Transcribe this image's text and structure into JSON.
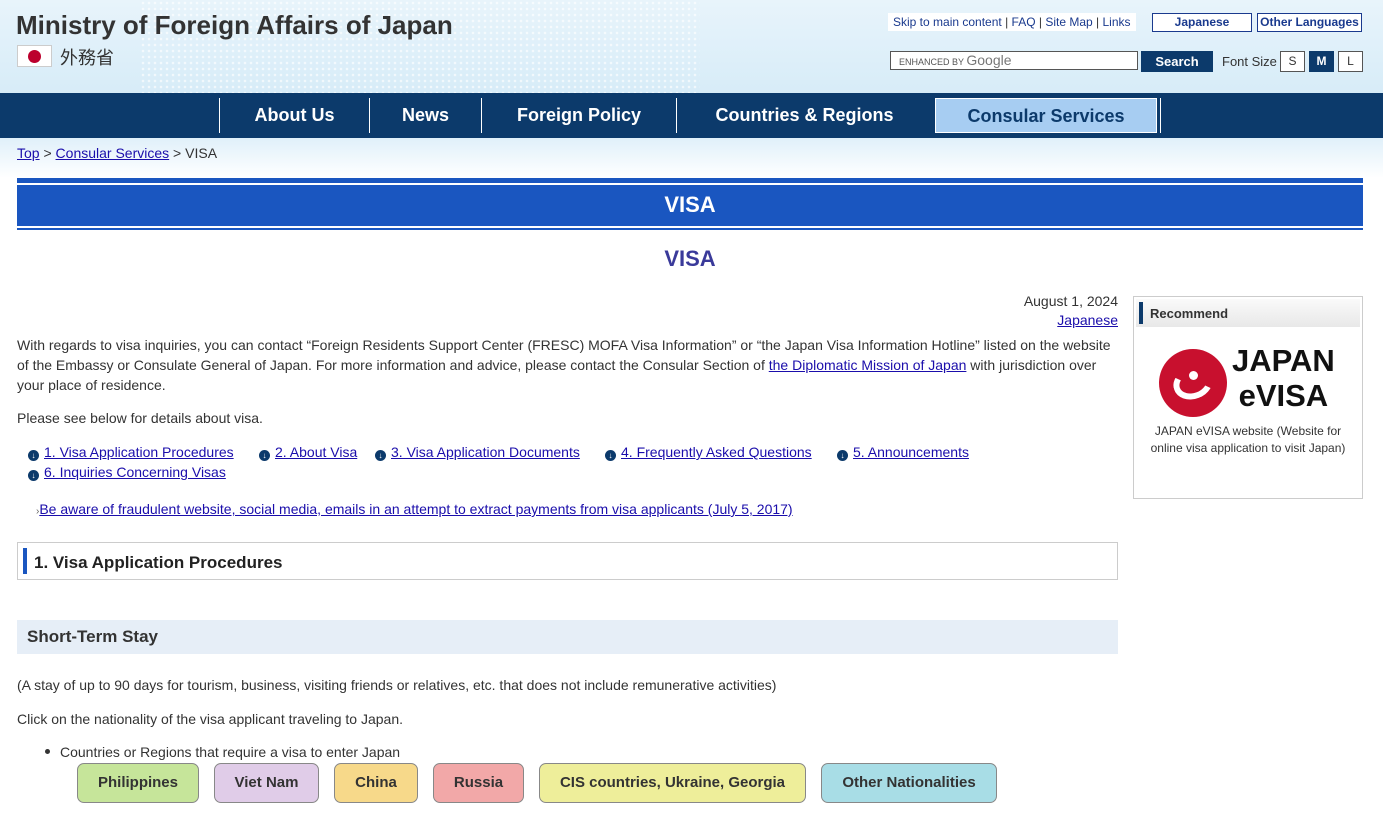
{
  "header": {
    "site_title": "Ministry of Foreign Affairs of Japan",
    "japanese_name": "外務省",
    "top_links": [
      "Skip to main content",
      "FAQ",
      "Site Map",
      "Links"
    ],
    "language_japanese": "Japanese",
    "language_other": "Other Languages",
    "search_placeholder_enhanced": "ENHANCED BY",
    "search_placeholder_google": "Google",
    "search_button": "Search",
    "font_size_label": "Font Size",
    "font_sizes": [
      "S",
      "M",
      "L"
    ],
    "font_size_selected": "M"
  },
  "nav": {
    "items": [
      {
        "label": "About Us"
      },
      {
        "label": "News"
      },
      {
        "label": "Foreign Policy"
      },
      {
        "label": "Countries & Regions"
      },
      {
        "label": "Consular Services"
      }
    ],
    "active": "Consular Services"
  },
  "breadcrumb": {
    "top": "Top",
    "sep": ">",
    "consular": "Consular Services",
    "current": "VISA"
  },
  "page": {
    "banner_title": "VISA",
    "subtitle": "VISA",
    "date": "August 1, 2024",
    "japanese_link": "Japanese",
    "intro_part1": "With regards to visa inquiries, you can contact “Foreign Residents Support Center (FRESC) MOFA Visa Information” or “the Japan Visa Information Hotline” listed on the website of the Embassy or Consulate General of Japan. For more information and advice, please contact the Consular Section of ",
    "intro_link": "the Diplomatic Mission of Japan",
    "intro_part2": " with jurisdiction over your place of residence.",
    "details_text": "Please see below for details about visa.",
    "toc": [
      "1. Visa Application Procedures",
      "2. About Visa",
      "3. Visa Application Documents",
      "4. Frequently Asked Questions",
      "5. Announcements",
      "6. Inquiries Concerning Visas"
    ],
    "warning_link": "Be aware of fraudulent website, social media, emails in an attempt to extract payments from visa applicants (July 5, 2017)",
    "section_heading": "1. Visa Application Procedures",
    "subsection_heading": "Short-Term Stay",
    "short_term_desc": "(A stay of up to 90 days for tourism, business, visiting friends or relatives, etc. that does not include remunerative activities)",
    "click_instruction": "Click on the nationality of the visa applicant traveling to Japan.",
    "bullet_text": "Countries or Regions that require a visa to enter Japan",
    "nationality_buttons": [
      {
        "label": "Philippines",
        "color": "#c6e59a"
      },
      {
        "label": "Viet Nam",
        "color": "#e0cce8"
      },
      {
        "label": "China",
        "color": "#f7d98a"
      },
      {
        "label": "Russia",
        "color": "#f2a8a8"
      },
      {
        "label": "CIS countries, Ukraine, Georgia",
        "color": "#eeee9a"
      },
      {
        "label": "Other Nationalities",
        "color": "#a8dde6"
      }
    ]
  },
  "sidebar": {
    "heading": "Recommend",
    "logo_line1": "JAPAN",
    "logo_line2": "eVISA",
    "caption": "JAPAN eVISA website (Website for online visa application to visit Japan)"
  },
  "colors": {
    "nav_bg": "#0c3a6b",
    "nav_active_bg": "#a7cdf2",
    "banner_bg": "#1a56c0",
    "subtitle": "#3a3a9a",
    "link": "#1a0dab"
  }
}
